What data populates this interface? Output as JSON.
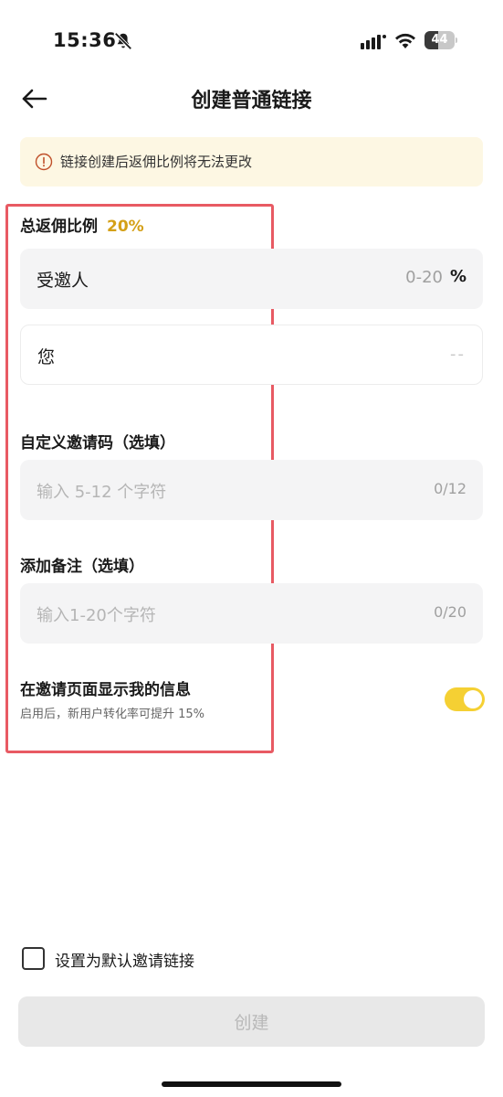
{
  "status": {
    "time": "15:36",
    "battery": "44",
    "battery_level": 0.44
  },
  "nav": {
    "title": "创建普通链接"
  },
  "notice": {
    "text": "链接创建后返佣比例将无法更改"
  },
  "rebate": {
    "title": "总返佣比例",
    "value": "20%",
    "invitee_label": "受邀人",
    "invitee_range": "0-20",
    "invitee_unit": "%",
    "you_label": "您",
    "you_value": "--"
  },
  "invite_code": {
    "title": "自定义邀请码（选填）",
    "placeholder": "输入 5-12 个字符",
    "count": "0/12"
  },
  "remark": {
    "title": "添加备注（选填）",
    "placeholder": "输入1-20个字符",
    "count": "0/20"
  },
  "show_info": {
    "title": "在邀请页面显示我的信息",
    "subtitle": "启用后，新用户转化率可提升 15%",
    "enabled": true
  },
  "default_link": {
    "label": "设置为默认邀请链接",
    "checked": false
  },
  "create_button": {
    "label": "创建"
  },
  "colors": {
    "accent": "#f5d033",
    "rate": "#d4a017",
    "highlight": "#e85a63",
    "notice_bg": "#fdf7e3"
  }
}
